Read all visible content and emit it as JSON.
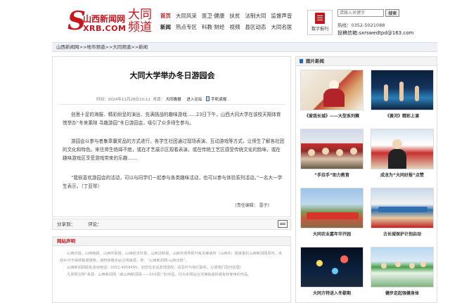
{
  "header": {
    "logo": {
      "letter": "S",
      "site_name": "山西新闻网",
      "domain": "XRB.COM",
      "city": "大同",
      "channel": "频道"
    },
    "nav_row1": [
      "首页",
      "大同风采",
      "医卫·健康",
      "扶贫",
      "法制大同",
      "监督声音"
    ],
    "nav_row2": [
      "新闻",
      "热点专区",
      "科教·财经",
      "视频",
      "县区动态",
      "大同名医"
    ],
    "ebook_label": "数字报刊",
    "search": {
      "placeholder": "请输入关键字",
      "button_label": "搜索"
    },
    "hotline": "热线：0352-5021088",
    "submit_email": "投稿信箱:sxrswedtpd@163.com"
  },
  "breadcrumb": "山西新闻网>>地市频道>>大同频道>>新闻",
  "article": {
    "title": "大同大学举办冬日游园会",
    "time_label": "时间：",
    "time": "2024年11月28日10:11",
    "source_label": "来源：",
    "source": "大同晚报",
    "forum_link": "进入论坛",
    "mobile_link": "手机读报",
    "paragraphs": [
      "创意十足的海报、精彩纷呈的演出、充满挑战的趣味游戏……23日下午，山西大同大学在该校天翔体育馆举办“冬来乘隙 寻趣游园”冬日游园会，吸引了众多师生参与。",
      "游园会以参与者集章赢奖品的方式进行，各学生社团通过现场表演、互动游戏等方式，让师生了解各社团的文化和特色。来往师生络绎不绝，或在才艺展示区观看表演，或在传统工艺区感受传统文化的韵味，或在趣味游戏区享受游戏带来的乐趣……",
      "“我很喜欢游园会的活动，可以与同学们一起参与各类趣味活动，也可以参与体验系列活动。”一名大一学生表示。（丁亚琴）"
    ],
    "editor": "(责任编辑：  雷子)"
  },
  "share_bar": {
    "share_label": "分享到：",
    "comment_label": "评论："
  },
  "disclaimer": {
    "heading": "网站声明",
    "paragraphs": [
      "山西日报、山西晚报、山西市民报、山西经济日报、山西法制报、山西市场导报刊有关等版权（山西共）独家委托山西新闻网发布，未经许可不得转载或镜像，授权转载务必注明来源，例：“山西新闻网-山西日报”。",
      "山西新闻网联系咨询电话：0351-4058495，如您在本站发现侵权，请及时与我们联系，以便我们及时处理！",
      "凡本网注明“来源：山西新闻网（或山西新闻网——XXX报）”的作品，均为本网站合法拥有版权或有权使用的作品。"
    ]
  },
  "sidebar": {
    "heading": "图片新闻",
    "photos": [
      {
        "caption": "《爱我长城》——大型系列赛"
      },
      {
        "caption": "《黄河》精彩上演"
      },
      {
        "caption": "“手拉手”助力教育"
      },
      {
        "caption": "成龙为“大同好报”点赞"
      },
      {
        "caption": "大同农业嘉年华开园"
      },
      {
        "caption": "古长城保护计划启动"
      },
      {
        "caption": "大同方特进入冬歇期"
      },
      {
        "caption": "健步走起强健身体"
      }
    ]
  }
}
